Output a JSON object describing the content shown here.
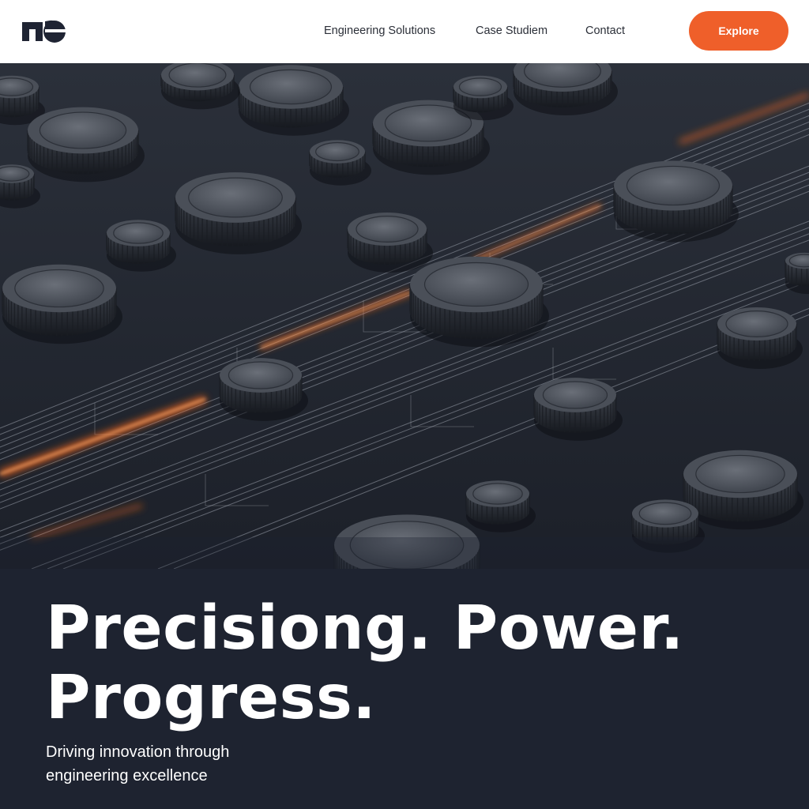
{
  "brand": {
    "logo_icon": "brand-logo-icon",
    "colors": {
      "accent": "#ef5f2a",
      "dark": "#1e2330",
      "ink": "#1f2433"
    }
  },
  "nav": {
    "items": [
      {
        "label": "Engineering Solutions"
      },
      {
        "label": "Case Studiem"
      },
      {
        "label": "Contact"
      }
    ],
    "cta_label": "Explore"
  },
  "hero": {
    "headline_line1": "Precisiong. Power.",
    "headline_line2": "Progress.",
    "tagline_line1": "Driving innovation through",
    "tagline_line2": "engineering excellence"
  }
}
